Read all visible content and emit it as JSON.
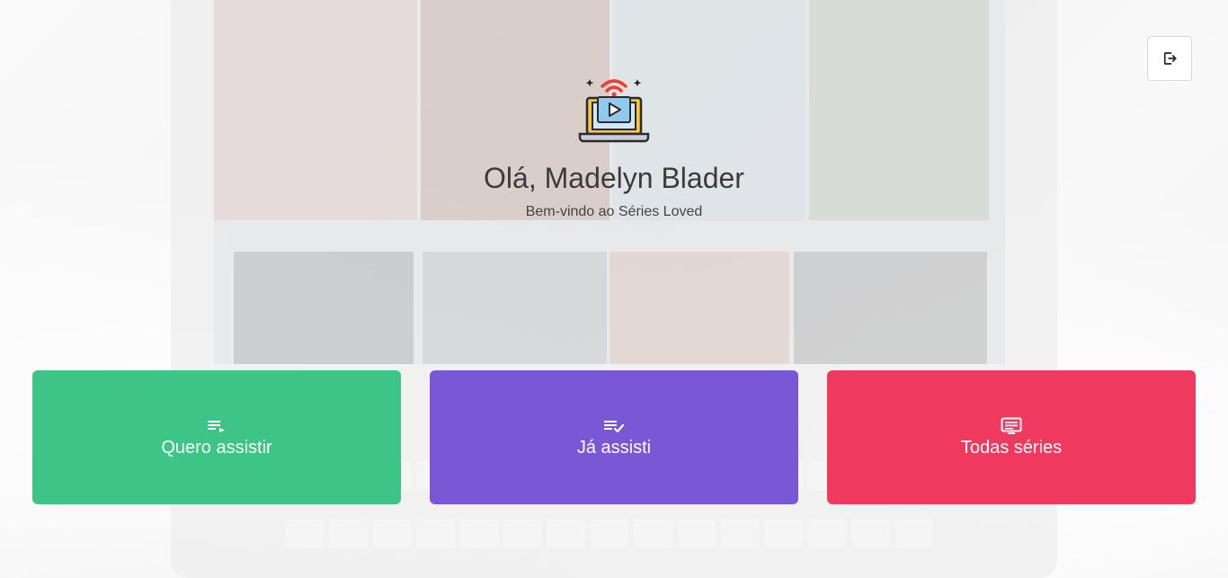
{
  "header": {
    "greeting": "Olá, Madelyn Blader",
    "subtitle": "Bem-vindo ao Séries Loved"
  },
  "logo": {
    "icon": "laptop-streaming-icon"
  },
  "logout": {
    "icon": "logout-icon"
  },
  "cards": [
    {
      "label": "Quero assistir",
      "icon": "playlist-add-icon",
      "color": "#3dc486"
    },
    {
      "label": "Já assisti",
      "icon": "playlist-check-icon",
      "color": "#7a57d4"
    },
    {
      "label": "Todas séries",
      "icon": "tv-list-icon",
      "color": "#f0395e"
    }
  ]
}
